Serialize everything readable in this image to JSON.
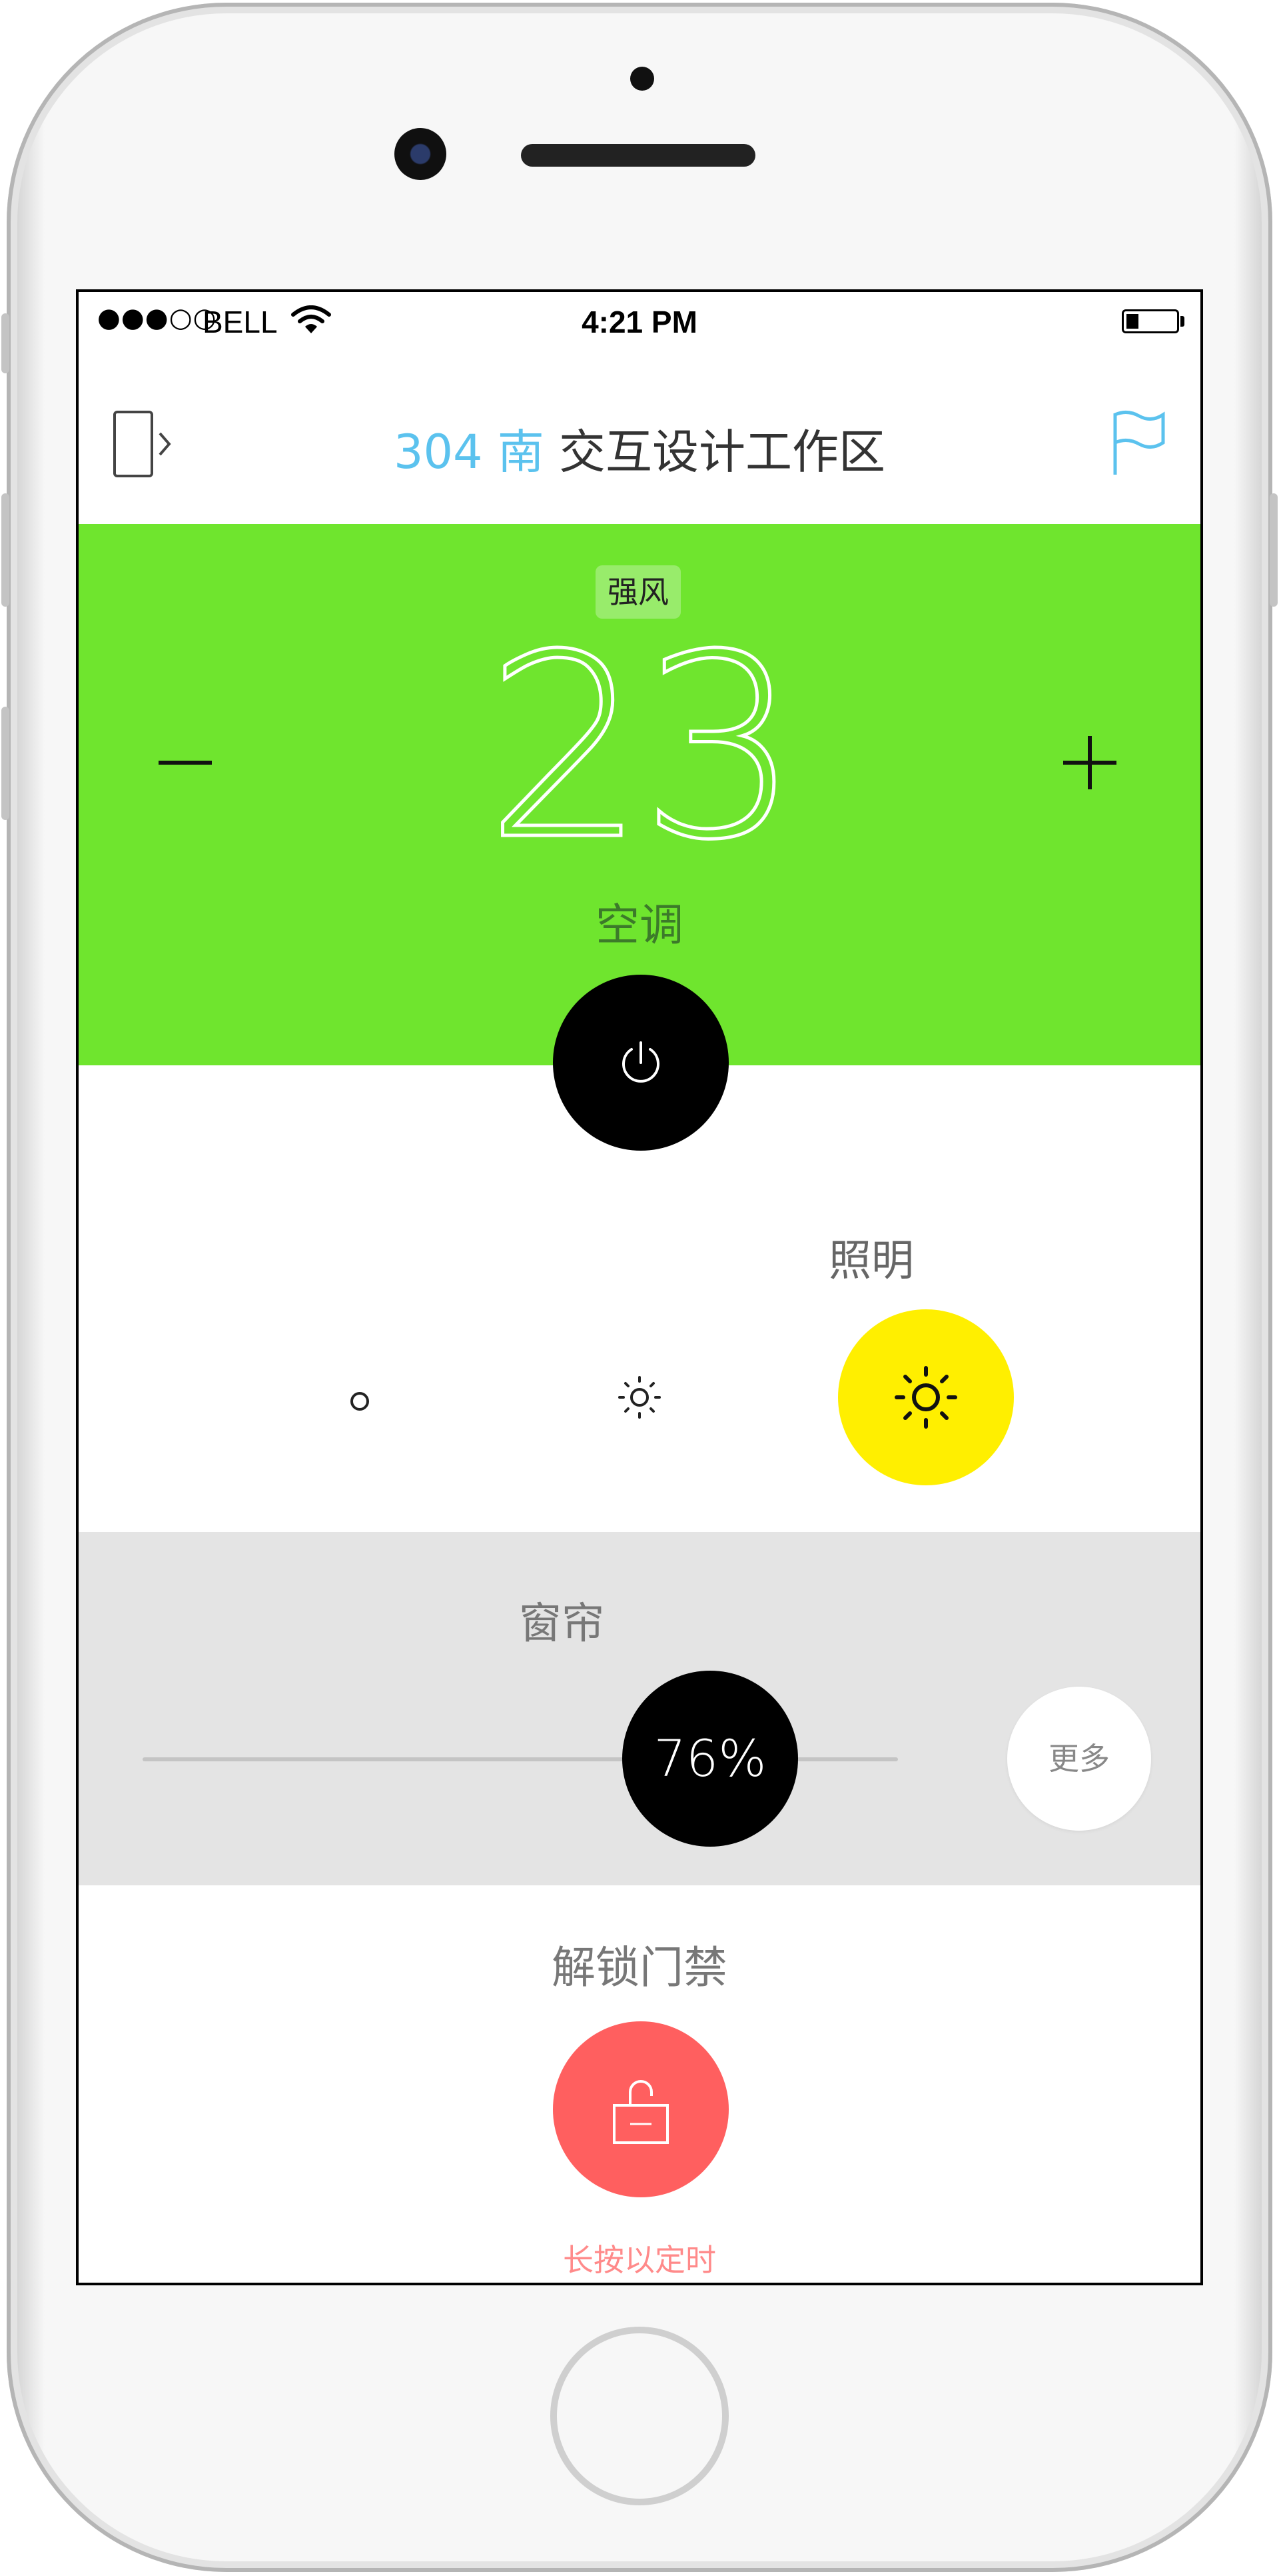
{
  "status_bar": {
    "signal": "●●●○○",
    "carrier": "BELL",
    "time": "4:21 PM"
  },
  "nav": {
    "room_number": "304 南",
    "room_name": " 交互设计工作区",
    "left_icon": "exit-door-icon",
    "right_icon": "flag-icon"
  },
  "ac": {
    "wind_mode": "强风",
    "temperature": "23",
    "label": "空调",
    "minus_icon": "minus-icon",
    "plus_icon": "plus-icon",
    "power_icon": "power-icon",
    "panel_color": "#6fe52e"
  },
  "lighting": {
    "label": "照明",
    "levels": [
      "off",
      "dim",
      "bright"
    ],
    "selected_level": "bright",
    "highlight_color": "#ffef00"
  },
  "curtain": {
    "label": "窗帘",
    "value": "76%",
    "more_label": "更多"
  },
  "door": {
    "label": "解锁门禁",
    "hint": "长按以定时",
    "unlock_icon": "unlock-icon",
    "button_color": "#ff5f5f"
  }
}
